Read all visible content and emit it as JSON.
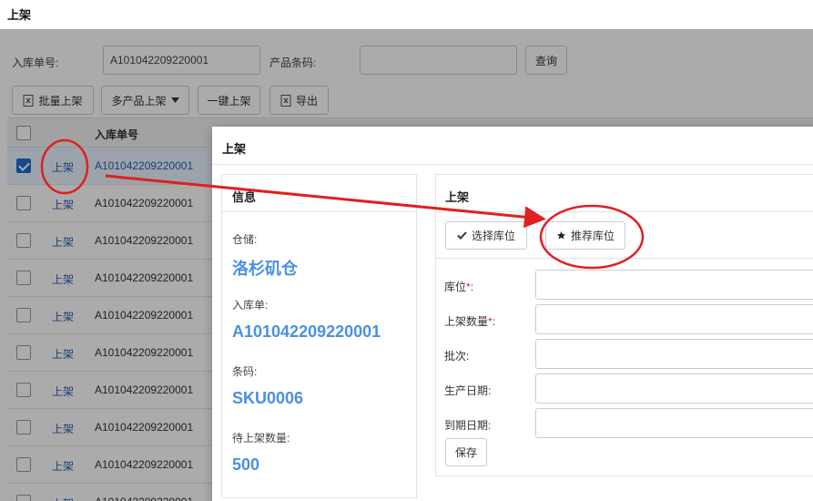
{
  "page": {
    "title": "上架"
  },
  "search": {
    "order_label": "入库单号:",
    "order_value": "A101042209220001",
    "barcode_label": "产品条码:",
    "barcode_value": "",
    "query_button": "查询"
  },
  "toolbar": {
    "batch_label": "批量上架",
    "multi_label": "多产品上架",
    "onekey_label": "一键上架",
    "export_label": "导出"
  },
  "table": {
    "col_order": "入库单号",
    "action_label": "上架",
    "rows": [
      {
        "order": "A101042209220001",
        "selected": true
      },
      {
        "order": "A101042209220001",
        "selected": false
      },
      {
        "order": "A101042209220001",
        "selected": false
      },
      {
        "order": "A101042209220001",
        "selected": false
      },
      {
        "order": "A101042209220001",
        "selected": false
      },
      {
        "order": "A101042209220001",
        "selected": false
      },
      {
        "order": "A101042209220001",
        "selected": false
      },
      {
        "order": "A101042209220001",
        "selected": false
      },
      {
        "order": "A101042209220001",
        "selected": false
      },
      {
        "order": "A101042209220001",
        "selected": false
      }
    ]
  },
  "modal": {
    "title": "上架",
    "info": {
      "title": "信息",
      "warehouse_label": "仓储:",
      "warehouse_value": "洛杉矶仓",
      "inbound_label": "入库单:",
      "inbound_value": "A101042209220001",
      "barcode_label": "条码:",
      "barcode_value": "SKU0006",
      "pending_label": "待上架数量:",
      "pending_value": "500"
    },
    "shelve": {
      "title": "上架",
      "select_location_button": "选择库位",
      "recommend_location_button": "推荐库位",
      "location_label": "库位",
      "qty_label": "上架数量",
      "required_mark": "*",
      "colon": ":",
      "batch_label": "批次:",
      "production_date_label": "生产日期:",
      "expiry_date_label": "到期日期:",
      "save_button": "保存"
    }
  },
  "colors": {
    "link": "#2a5db0",
    "info_value": "#4a90e2",
    "checkbox_checked": "#1e6fd0",
    "annotation": "#e02020",
    "required": "#d9232e"
  }
}
